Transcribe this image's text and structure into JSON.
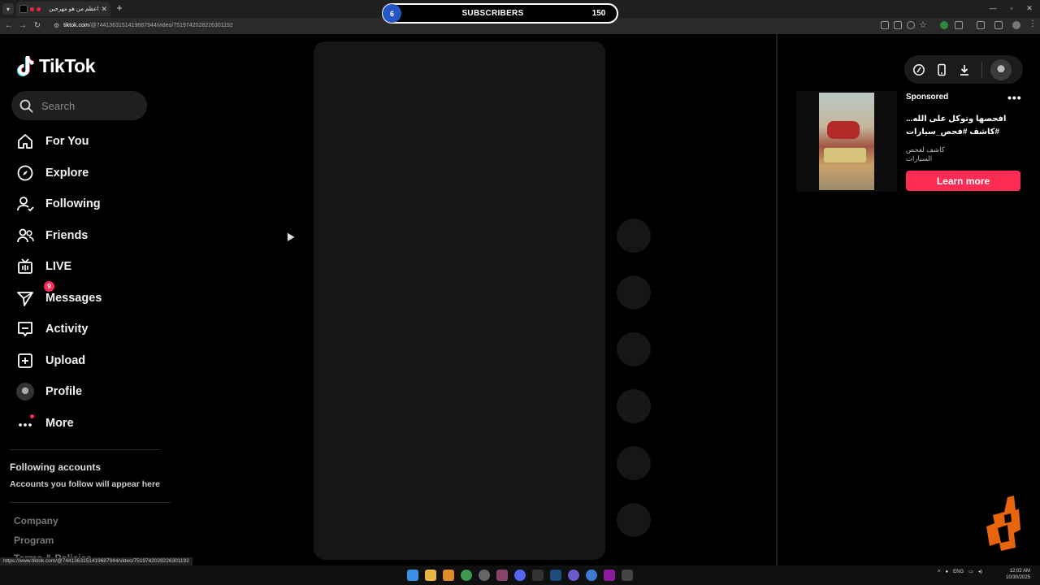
{
  "browser": {
    "tab_title": "اعظم من هو مهرجين",
    "url_host": "tiktok.com",
    "url_path": "/@7441363151419687944/video/7519742028226301192",
    "status_url": "https://www.tiktok.com/@7441363151419687944/video/7519742028226301192"
  },
  "overlay": {
    "left_count": "6",
    "label": "SUBSCRIBERS",
    "right_count": "150"
  },
  "sidebar": {
    "logo": "TikTok",
    "search_placeholder": "Search",
    "items": [
      {
        "label": "For You"
      },
      {
        "label": "Explore"
      },
      {
        "label": "Following"
      },
      {
        "label": "Friends"
      },
      {
        "label": "LIVE"
      },
      {
        "label": "Messages",
        "badge": "9"
      },
      {
        "label": "Activity"
      },
      {
        "label": "Upload"
      },
      {
        "label": "Profile"
      },
      {
        "label": "More"
      }
    ],
    "following_title": "Following accounts",
    "following_sub": "Accounts you follow will appear here",
    "footer": [
      "Company",
      "Program",
      "Terms & Policies"
    ]
  },
  "ad": {
    "sponsored": "Sponsored",
    "title": "افحصها وتوكل على الله... #كاشف #فحص_سيارات",
    "brand": "كاشف لفحص السيارات",
    "cta": "Learn more"
  },
  "system": {
    "language": "ENG",
    "time": "12:02 AM",
    "date": "10/30/2025"
  },
  "colors": {
    "accent": "#fe2c55",
    "background": "#000000",
    "overlay_blue": "#2457c5"
  }
}
